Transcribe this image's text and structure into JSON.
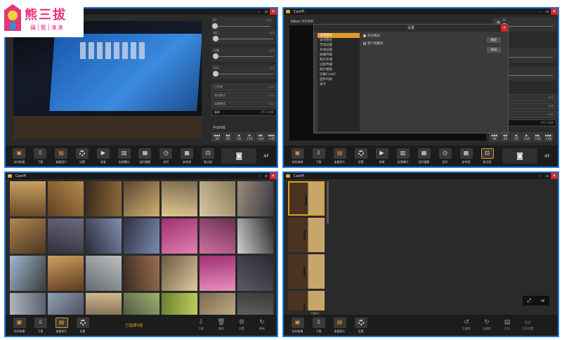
{
  "logo": {
    "title": "熊三拔",
    "subtitle": "攝│覧│湊湊"
  },
  "q1": {
    "params": {
      "ev": "EV",
      "shutter": "快门",
      "aperture": "光圈",
      "iso": "ISO",
      "wb": "白平衡",
      "metering": "测光模式",
      "focus": "对焦模式",
      "quality": "画质"
    },
    "value_placeholder": "自动",
    "image_quality": "JPEG 精细",
    "auto_button": "自动",
    "focus_title": "手动对焦",
    "focus_steps": [
      {
        "sym": "◀◀◀",
        "n": "-3X"
      },
      {
        "sym": "◀◀",
        "n": "-2X"
      },
      {
        "sym": "◀",
        "n": "-1X"
      },
      {
        "sym": "▶",
        "n": "+1X"
      },
      {
        "sym": "▶▶",
        "n": "+2X"
      },
      {
        "sym": "▶▶▶",
        "n": "+3X"
      }
    ],
    "toolbar": [
      "实时取景",
      "下载",
      "查看照片",
      "设置",
      "录像",
      "包围曝光",
      "延时摄影",
      "定时",
      "参考线",
      "焦点框"
    ],
    "af_label": "AF",
    "capture_icon": "camera-icon"
  },
  "q2": {
    "app_title": "CamFi",
    "camera_name": "Nikon D5300",
    "dialog": {
      "title": "设置",
      "menu": [
        "连接模式",
        "访问密码",
        "无线设置",
        "有线设置",
        "拍摄传输",
        "照片存储",
        "远程传输",
        "照片模板",
        "切换CamFi",
        "固件升级",
        "关于"
      ],
      "option1": "热点模式",
      "option2": "客户端模式",
      "btn1": "确定",
      "btn2": "取消"
    }
  },
  "q3": {
    "app_title": "CamFi",
    "toolbar": [
      "实时取景",
      "下载",
      "查看照片",
      "设置"
    ],
    "selected_text": "已选择0张",
    "actions": [
      "下载",
      "删除",
      "设置",
      "刷新"
    ]
  },
  "q4": {
    "app_title": "CamFi",
    "status": "下载中",
    "toolbar": [
      "实时取景",
      "下载",
      "查看照片",
      "设置"
    ],
    "actions": [
      "左旋转",
      "右旋转",
      "打印",
      "打开位置"
    ]
  },
  "colors": {
    "accent": "#e39a2a",
    "frame": "#1e7ad6",
    "close": "#d4242a",
    "logo_bg": "#ffffff",
    "logo_text": "#e7347a"
  }
}
